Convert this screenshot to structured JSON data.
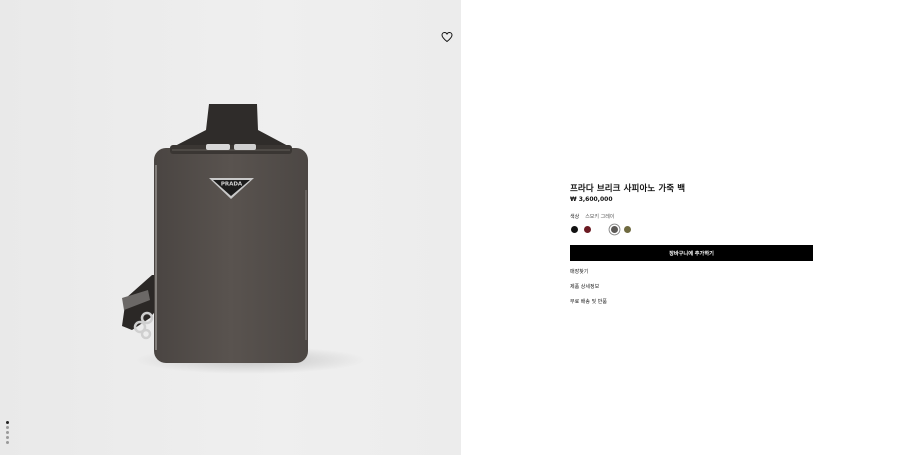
{
  "product": {
    "title": "프라다 브리크 사피아노 가죽 백",
    "price": "₩ 3,600,000",
    "color_label": "색상",
    "color_value": "스모키 그레이",
    "swatches": [
      {
        "name": "black",
        "hex": "#111111"
      },
      {
        "name": "burgundy",
        "hex": "#6b1a22"
      },
      {
        "name": "white",
        "hex": "#ffffff"
      },
      {
        "name": "smoky-gray",
        "hex": "#5c5956",
        "selected": true
      },
      {
        "name": "olive",
        "hex": "#6f6a40"
      }
    ],
    "add_to_cart": "장바구니에 추가하기",
    "links": [
      "매장찾기",
      "제품 상세정보",
      "무료 배송 및 반품"
    ]
  },
  "gallery": {
    "wishlist_icon": "heart-outline-icon",
    "logo_text": "PRADA",
    "image_count": 5,
    "active_index": 0
  }
}
